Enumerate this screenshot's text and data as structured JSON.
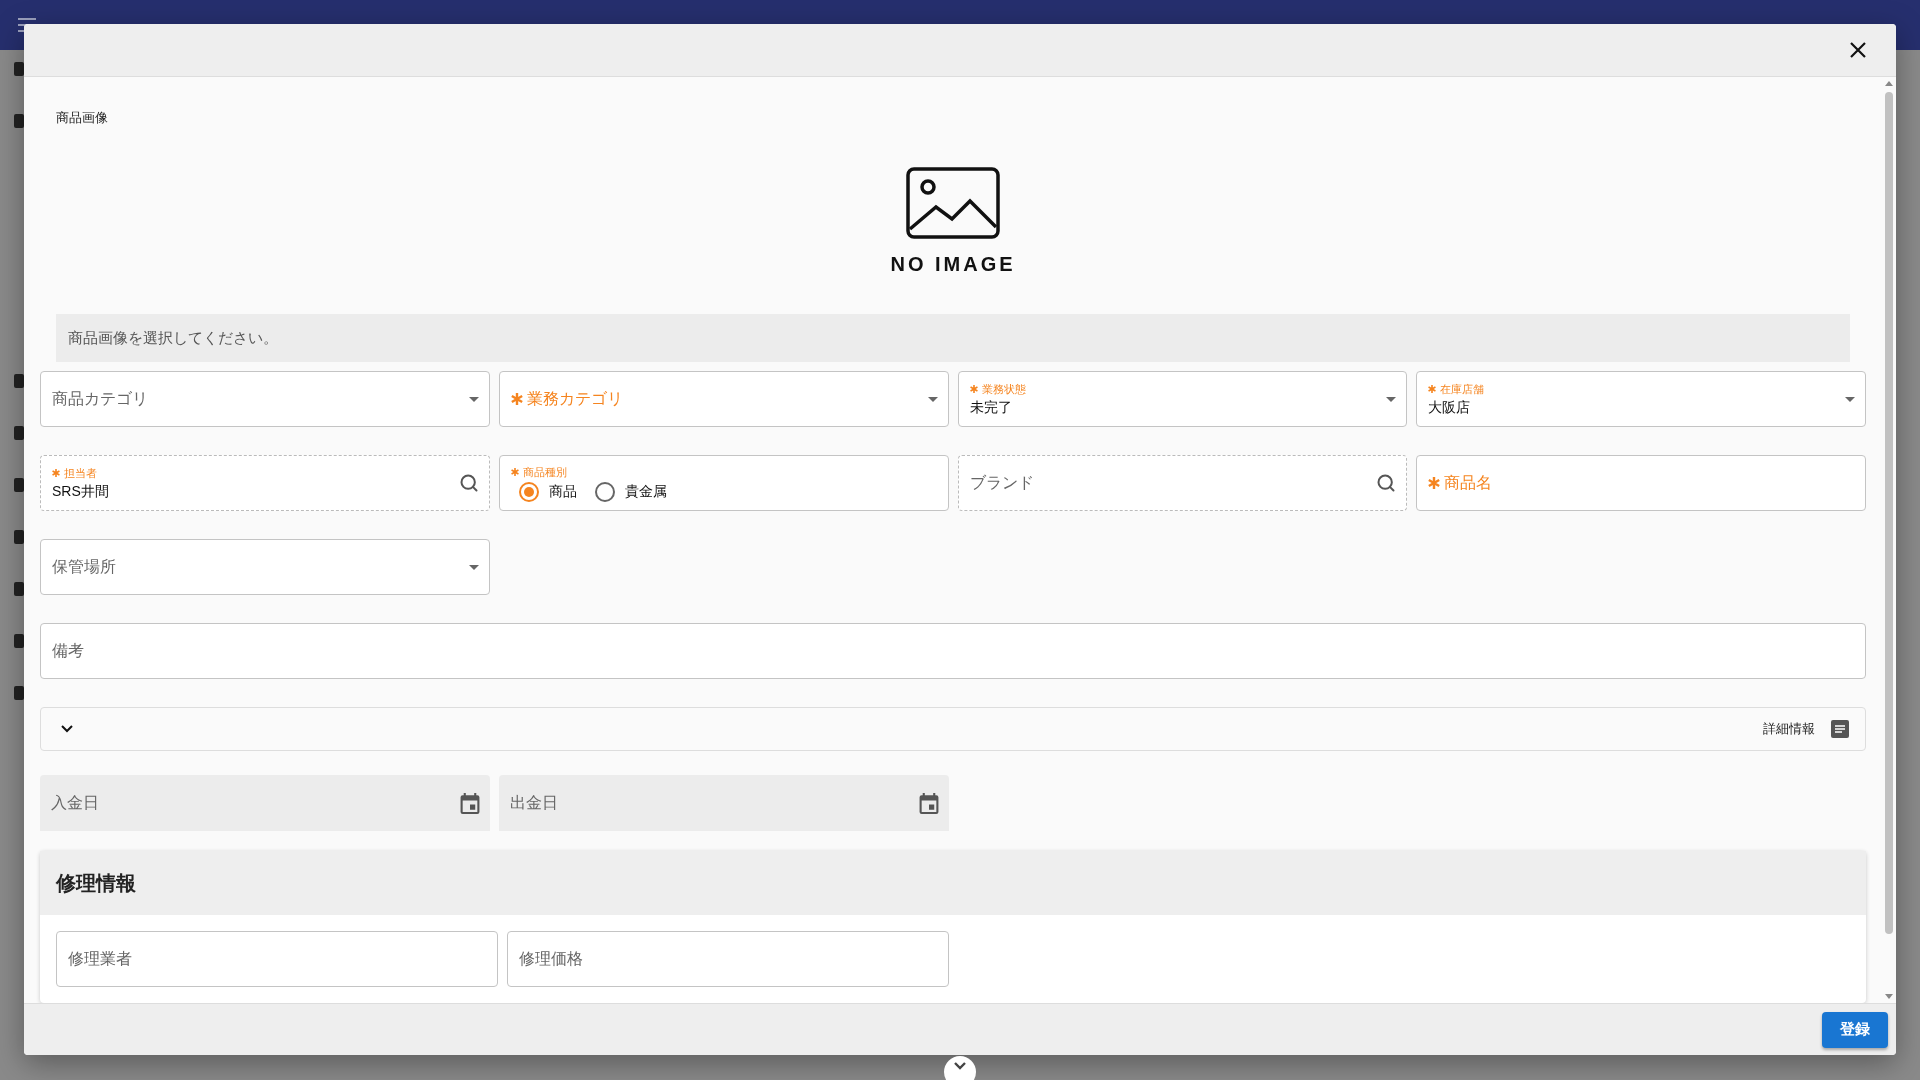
{
  "dialog": {
    "image_section": {
      "label": "商品画像",
      "no_image_text": "NO IMAGE",
      "hint": "商品画像を選択してください。"
    },
    "rows": [
      {
        "fields": [
          {
            "kind": "select",
            "label": "商品カテゴリ",
            "required": false
          },
          {
            "kind": "select",
            "label": "業務カテゴリ",
            "required": true
          },
          {
            "kind": "select",
            "label": "業務状態",
            "required": true,
            "value": "未完了"
          },
          {
            "kind": "select",
            "label": "在庫店舗",
            "required": true,
            "value": "大阪店"
          }
        ]
      },
      {
        "fields": [
          {
            "kind": "search",
            "label": "担当者",
            "required": true,
            "value": "SRS井間"
          },
          {
            "kind": "radio",
            "label": "商品種別",
            "required": true,
            "options": [
              {
                "label": "商品",
                "selected": true
              },
              {
                "label": "貴金属",
                "selected": false
              }
            ]
          },
          {
            "kind": "search",
            "label": "ブランド",
            "required": false
          },
          {
            "kind": "text",
            "label": "商品名",
            "required": true
          }
        ]
      },
      {
        "fields": [
          {
            "kind": "select",
            "label": "保管場所",
            "required": false
          }
        ]
      },
      {
        "fields": [
          {
            "kind": "wide",
            "label": "備考",
            "required": false
          }
        ]
      }
    ],
    "details": {
      "title": "詳細情報",
      "expanded": false
    },
    "date_fields": [
      {
        "label": "入金日"
      },
      {
        "label": "出金日"
      }
    ],
    "repair_section": {
      "title": "修理情報",
      "fields": [
        {
          "label": "修理業者"
        },
        {
          "label": "修理価格"
        }
      ]
    },
    "submit_button": "登録"
  }
}
